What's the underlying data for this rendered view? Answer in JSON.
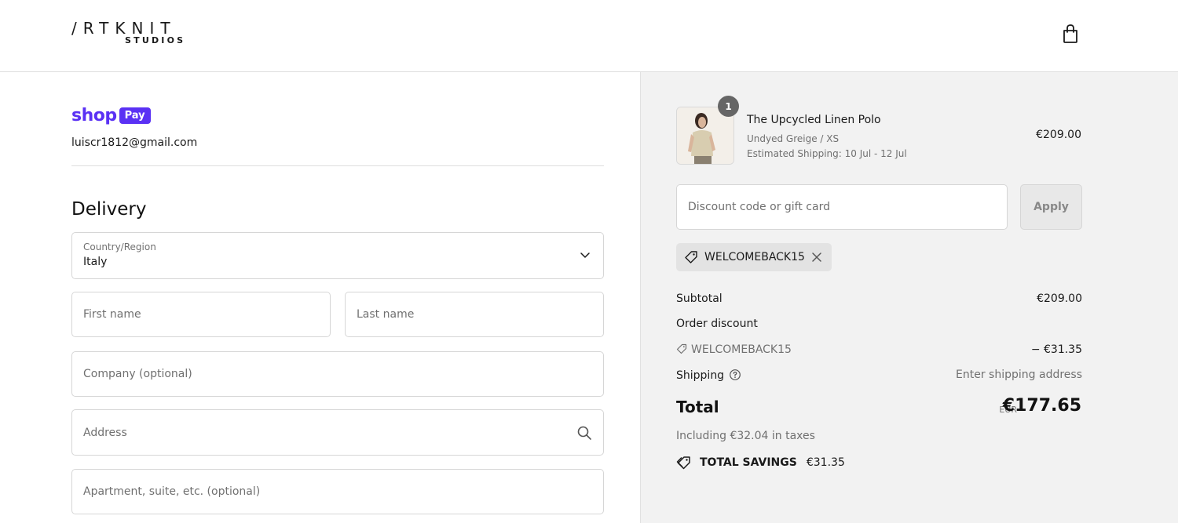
{
  "brand": {
    "logo_main": "/RTKNIT",
    "logo_sub": "STUDIOS"
  },
  "header": {
    "cart_icon": "shopping-bag-icon"
  },
  "express": {
    "shop_word": "shop",
    "pay_word": "Pay",
    "email": "luiscr1812@gmail.com"
  },
  "delivery": {
    "title": "Delivery",
    "country_label": "Country/Region",
    "country_value": "Italy",
    "first_name_placeholder": "First name",
    "last_name_placeholder": "Last name",
    "company_placeholder": "Company (optional)",
    "address_placeholder": "Address",
    "apartment_placeholder": "Apartment, suite, etc. (optional)"
  },
  "product": {
    "quantity": "1",
    "name": "The Upcycled Linen Polo",
    "variant": "Undyed Greige / XS",
    "shipping_estimate": "Estimated Shipping: 10 Jul - 12 Jul",
    "price": "€209.00"
  },
  "discount": {
    "placeholder": "Discount code or gift card",
    "apply_label": "Apply",
    "applied_code": "WELCOMEBACK15"
  },
  "summary": {
    "subtotal_label": "Subtotal",
    "subtotal_value": "€209.00",
    "order_discount_label": "Order discount",
    "discount_code": "WELCOMEBACK15",
    "discount_value": "− €31.35",
    "shipping_label": "Shipping",
    "shipping_value": "Enter shipping address",
    "total_label": "Total",
    "currency": "EUR",
    "total_value": "€177.65",
    "taxes_note": "Including €32.04 in taxes",
    "savings_label": "TOTAL SAVINGS",
    "savings_value": "€31.35"
  },
  "colors": {
    "shop_pay_purple": "#5a31f4",
    "summary_background": "#f2f2f2"
  }
}
